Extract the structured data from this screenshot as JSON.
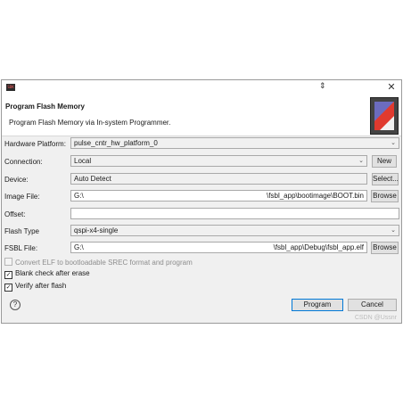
{
  "window": {
    "close_glyph": "✕",
    "cursor_glyph": "⇕",
    "app_icon_text": "SDK"
  },
  "header": {
    "title": "Program Flash Memory",
    "subtitle": "Program Flash Memory via In-system Programmer."
  },
  "form": {
    "hardware_platform": {
      "label": "Hardware Platform:",
      "value": "pulse_cntr_hw_platform_0"
    },
    "connection": {
      "label": "Connection:",
      "value": "Local",
      "new_label": "New"
    },
    "device": {
      "label": "Device:",
      "value": "Auto Detect",
      "select_label": "Select..."
    },
    "image_file": {
      "label": "Image File:",
      "value_left": "G:\\",
      "value_right": "\\fsbl_app\\bootimage\\BOOT.bin",
      "browse_label": "Browse"
    },
    "offset": {
      "label": "Offset:",
      "value": ""
    },
    "flash_type": {
      "label": "Flash Type",
      "value": "qspi-x4-single"
    },
    "fsbl_file": {
      "label": "FSBL File:",
      "value_left": "G:\\",
      "value_right": "\\fsbl_app\\Debug\\fsbl_app.elf",
      "browse_label": "Browse"
    }
  },
  "options": [
    {
      "label": "Convert ELF to bootloadable SREC format and program",
      "checked": false,
      "disabled": true
    },
    {
      "label": "Blank check after erase",
      "checked": true,
      "disabled": false
    },
    {
      "label": "Verify after flash",
      "checked": true,
      "disabled": false
    }
  ],
  "footer": {
    "help_glyph": "?",
    "program_label": "Program",
    "cancel_label": "Cancel",
    "watermark": "CSDN @Ussnr"
  },
  "colors": {
    "dialog_bg": "#f0f0f0",
    "accent": "#0078d7",
    "border": "#a9a9a9"
  }
}
